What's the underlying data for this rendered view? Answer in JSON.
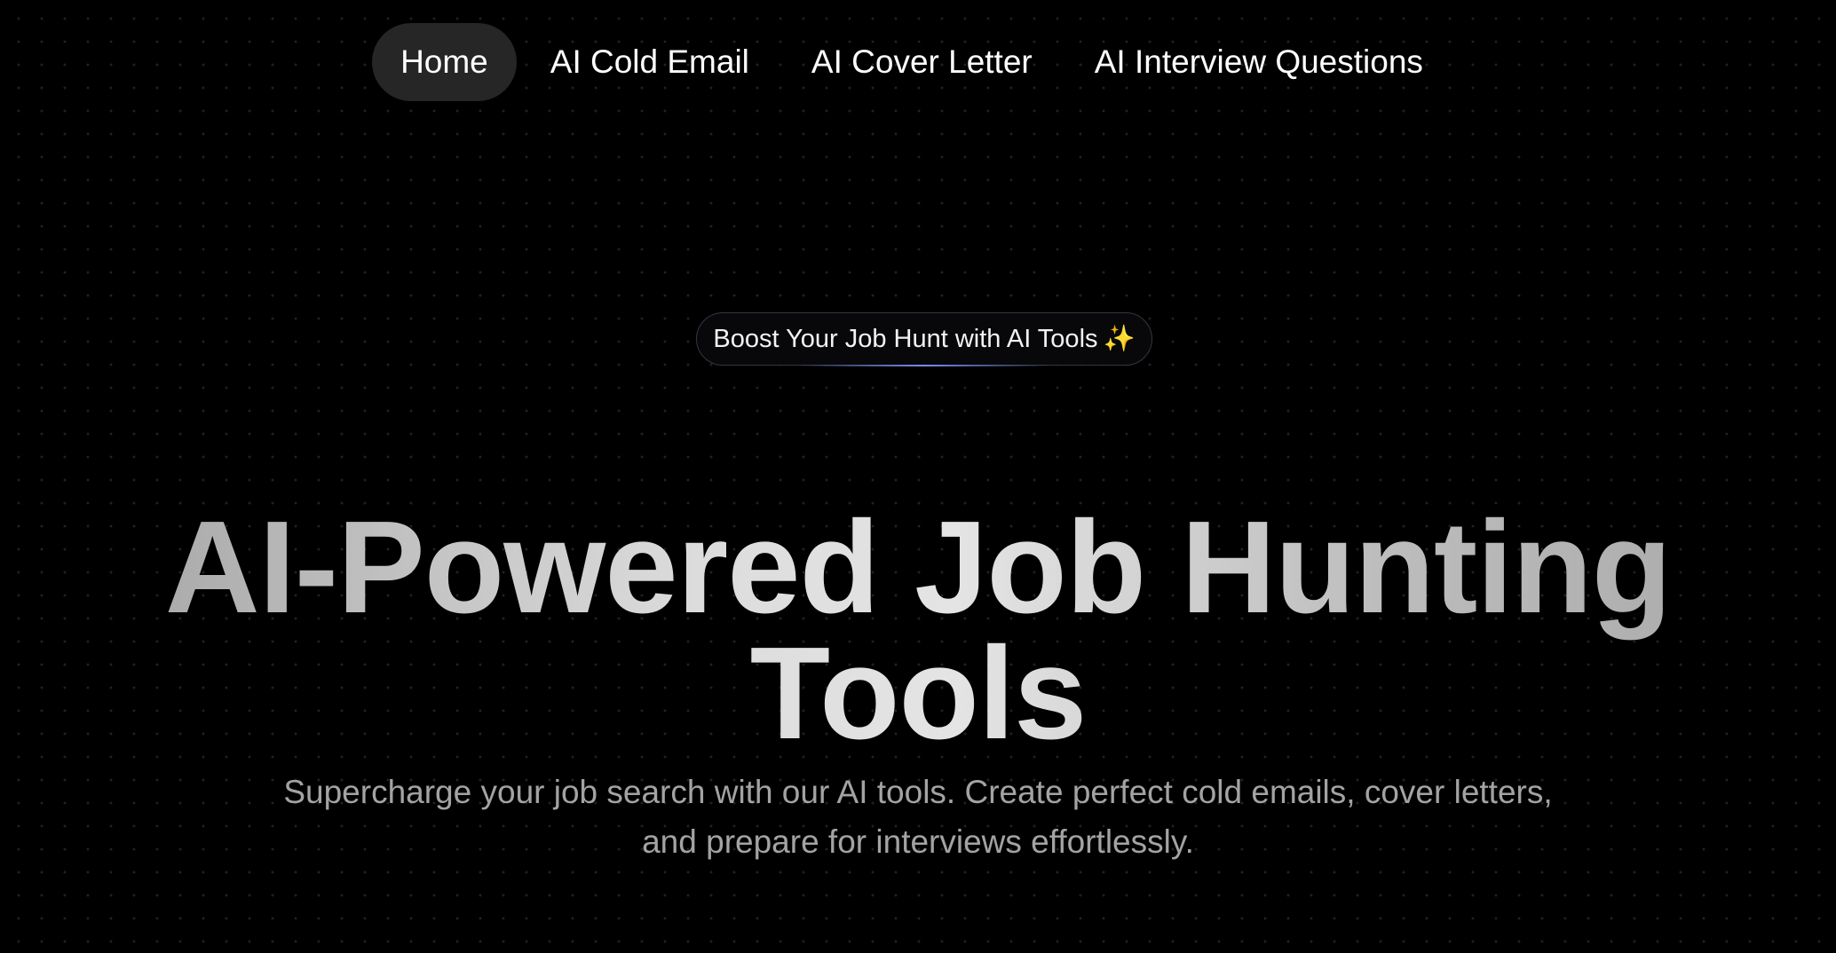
{
  "nav": {
    "items": [
      {
        "label": "Home",
        "active": true
      },
      {
        "label": "AI Cold Email",
        "active": false
      },
      {
        "label": "AI Cover Letter",
        "active": false
      },
      {
        "label": "AI Interview Questions",
        "active": false
      }
    ]
  },
  "hero": {
    "badge": {
      "text": "Boost Your Job Hunt with AI Tools",
      "emoji": "✨",
      "icon": "sparkles-icon"
    },
    "title_line1": "AI-Powered Job Hunting",
    "title_line2": "Tools",
    "subtitle_line1": "Supercharge your job search with our AI tools. Create perfect cold emails, cover letters,",
    "subtitle_line2": "and prepare for interviews effortlessly."
  },
  "colors": {
    "background": "#000000",
    "nav_active_bg": "#262626",
    "subtitle_text": "#a3a3a3",
    "badge_border": "#33363f",
    "badge_glow": "#7896ff"
  }
}
